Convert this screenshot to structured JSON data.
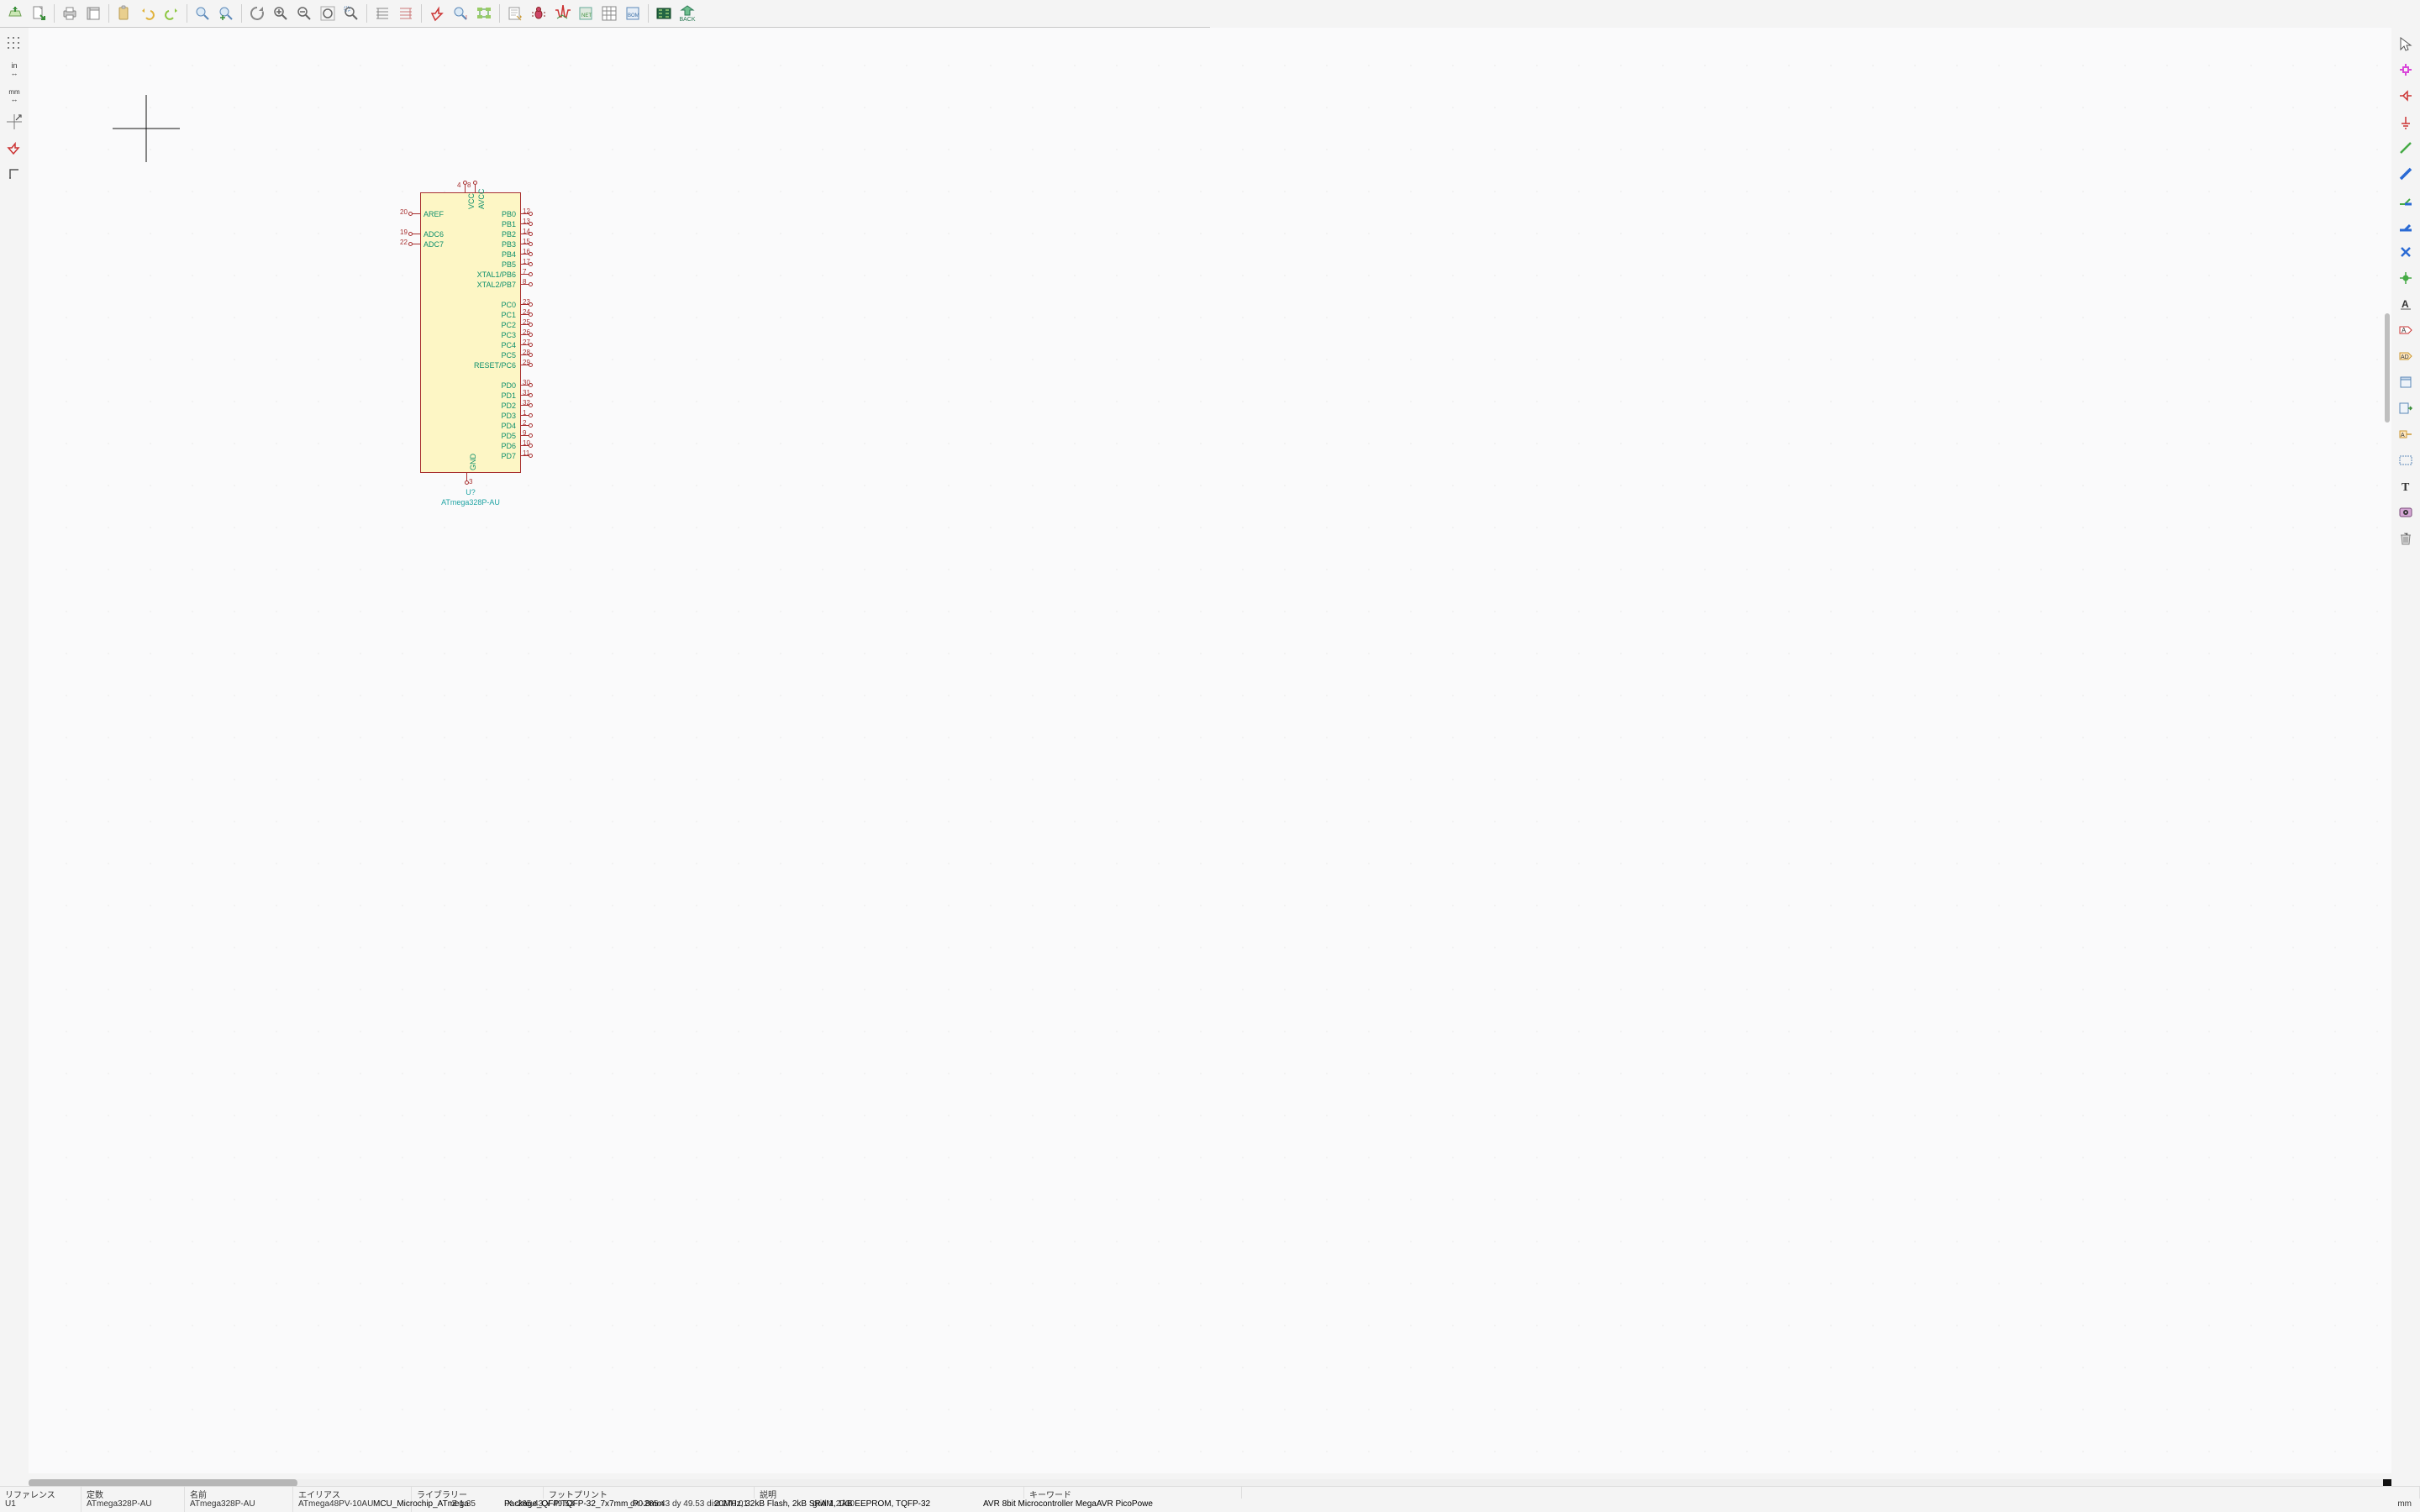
{
  "toolbar_top": {
    "tooltips": {
      "open": "Open",
      "new_sheet": "New sheet",
      "print": "Print",
      "page_settings": "Page settings",
      "paste": "Paste",
      "undo": "Undo",
      "redo": "Redo",
      "find": "Find",
      "replace": "Find/Replace",
      "refresh": "Refresh",
      "zoom_in": "Zoom in",
      "zoom_out": "Zoom out",
      "zoom_fit": "Zoom fit",
      "zoom_selection": "Zoom selection",
      "tree_open": "Expand hierarchy",
      "tree_leave": "Leave sheet",
      "run_erc": "ERC",
      "inspect": "Inspect",
      "erc_markers": "ERC markers",
      "annotate": "Annotate",
      "bug": "Debug",
      "sim": "Simulator",
      "netlist": "Netlist",
      "bom_table": "Symbol fields table",
      "bom": "Generate BOM",
      "pcb": "PCB editor",
      "back": "BACK"
    },
    "back_label": "BACK"
  },
  "left_toolbar": {
    "grid": "Grid",
    "inches": "in",
    "mm": "mm",
    "cursor_full": "Full crosshair",
    "hidden_pins": "Hidden pins",
    "origin": "Origin"
  },
  "right_toolbar": {
    "select": "Select",
    "highlight_net": "Highlight net",
    "add_symbol": "Add symbol",
    "add_power": "Add power port",
    "wire": "Wire",
    "bus": "Bus",
    "wire_entry": "Wire-to-bus entry",
    "bus_entry": "Bus-to-bus entry",
    "noconnect": "No-connect",
    "junction": "Junction",
    "net_label": "Net label",
    "global_label": "Global label",
    "hier_label": "Hierarchical label",
    "sheet": "Sheet",
    "import_sheet": "Import sheet pin",
    "hier_pin": "Hierarchical sheet pin",
    "text_box": "Textbox",
    "image": "Image",
    "delete": "Delete"
  },
  "component": {
    "ref": "U?",
    "value": "ATmega328P-AU",
    "top_pins": [
      {
        "name": "VCC",
        "num": "4"
      },
      {
        "name": "AVCC",
        "num": "8"
      }
    ],
    "bottom_pins": [
      {
        "name": "GND",
        "num": "3"
      }
    ],
    "left_pins": [
      {
        "name": "AREF",
        "num": "20"
      },
      null,
      {
        "name": "ADC6",
        "num": "19"
      },
      {
        "name": "ADC7",
        "num": "22"
      }
    ],
    "right_pins": [
      {
        "name": "PB0",
        "num": "12"
      },
      {
        "name": "PB1",
        "num": "13"
      },
      {
        "name": "PB2",
        "num": "14"
      },
      {
        "name": "PB3",
        "num": "15"
      },
      {
        "name": "PB4",
        "num": "16"
      },
      {
        "name": "PB5",
        "num": "17"
      },
      {
        "name": "XTAL1/PB6",
        "num": "7"
      },
      {
        "name": "XTAL2/PB7",
        "num": "8"
      },
      null,
      {
        "name": "PC0",
        "num": "23"
      },
      {
        "name": "PC1",
        "num": "24"
      },
      {
        "name": "PC2",
        "num": "25"
      },
      {
        "name": "PC3",
        "num": "26"
      },
      {
        "name": "PC4",
        "num": "27"
      },
      {
        "name": "PC5",
        "num": "28"
      },
      {
        "name": "RESET/PC6",
        "num": "29"
      },
      null,
      {
        "name": "PD0",
        "num": "30"
      },
      {
        "name": "PD1",
        "num": "31"
      },
      {
        "name": "PD2",
        "num": "32"
      },
      {
        "name": "PD3",
        "num": "1"
      },
      {
        "name": "PD4",
        "num": "2"
      },
      {
        "name": "PD5",
        "num": "9"
      },
      {
        "name": "PD6",
        "num": "10"
      },
      {
        "name": "PD7",
        "num": "11"
      }
    ]
  },
  "status_headers": {
    "reference": "リファレンス",
    "value": "定数",
    "name": "名前",
    "alias": "エイリアス",
    "library": "ライブラリー",
    "footprint": "フットプリント",
    "description": "説明",
    "keywords": "キーワード"
  },
  "status_values": {
    "reference": "U1",
    "value": "ATmega328P-AU",
    "name": "ATmega328P-AU",
    "alias": "ATmega48PV-10AU",
    "library": "MCU_Microchip_ATmega",
    "footprint": "Package_QFP:TQFP-32_7x7mm_P0.8mm",
    "description": "20MHz, 32kB Flash, 2kB SRAM, 1kB EEPROM, TQFP-32",
    "keywords": "AVR 8bit Microcontroller MegaAVR PicoPowe"
  },
  "coords": {
    "z": "Z 1.35",
    "xy": "X -265.43  Y 49.53",
    "d": "dx -265.43  dy 49.53  dist 270.01",
    "grid": "grid 1.2700",
    "unit": "mm"
  }
}
